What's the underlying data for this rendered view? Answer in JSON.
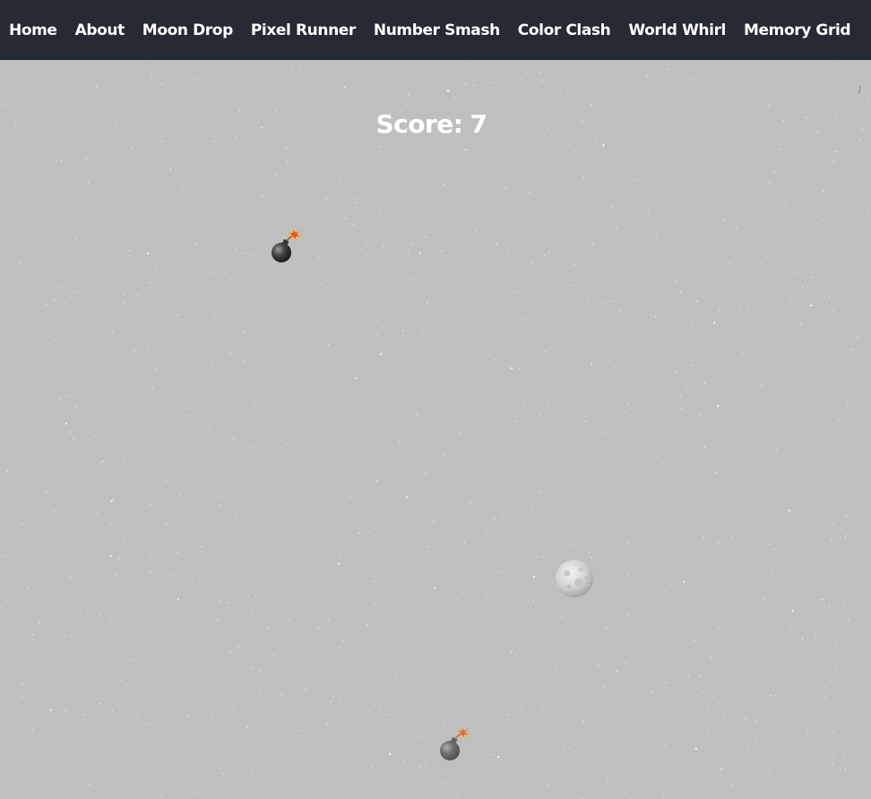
{
  "nav": {
    "links": [
      "Home",
      "About",
      "Moon Drop",
      "Pixel Runner",
      "Number Smash",
      "Color Clash",
      "World Whirl",
      "Memory Grid"
    ]
  },
  "game": {
    "score_label": "Score:",
    "score_value": "7",
    "sprites": [
      {
        "kind": "bomb",
        "icon": "bomb-icon",
        "lit": true
      },
      {
        "kind": "moon",
        "icon": "moon-icon"
      },
      {
        "kind": "bomb",
        "icon": "bomb-icon",
        "lit": true
      }
    ]
  },
  "colors": {
    "navbar_bg": "#262a33",
    "game_bg": "#bfbfbf",
    "text": "#ffffff",
    "bomb": "#3a3a3a",
    "moon": "#d9d9d9"
  }
}
